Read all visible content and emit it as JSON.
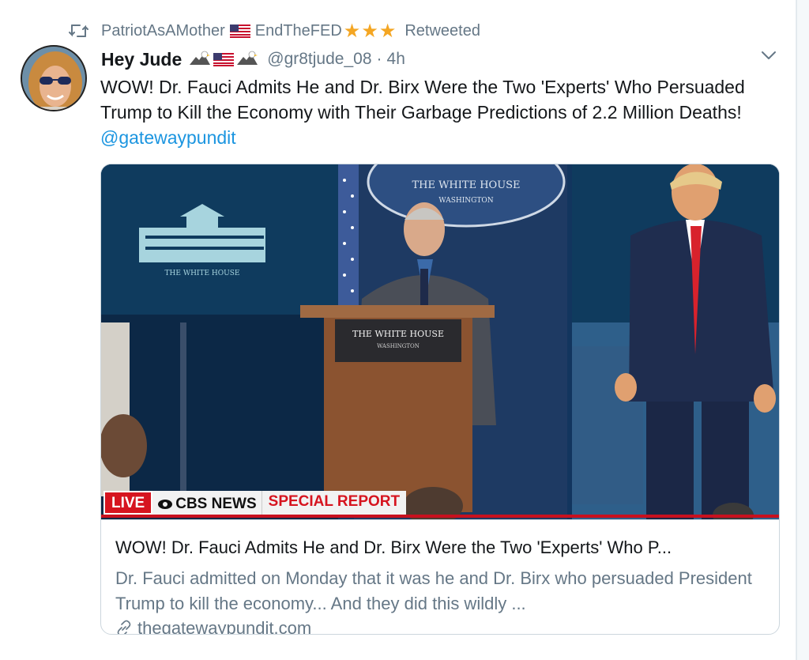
{
  "retweet": {
    "icon": "retweet-icon",
    "user1": "PatriotAsAMother",
    "user2": "EndTheFED",
    "stars": "★★★",
    "label": "Retweeted"
  },
  "tweet": {
    "display_name": "Hey Jude",
    "handle": "@gr8tjude_08",
    "dot": "·",
    "time": "4h",
    "text": "WOW! Dr. Fauci Admits He and Dr. Birx Were the Two 'Experts' Who Persuaded Trump to Kill the Economy with Their Garbage Predictions of 2.2 Million Deaths! ",
    "mention": "@gatewaypundit"
  },
  "card": {
    "title": "WOW! Dr. Fauci Admits He and Dr. Birx Were the Two 'Experts' Who P...",
    "description": "Dr. Fauci admitted on Monday that it was he and Dr. Birx who persuaded President Trump to kill the economy... And they did this wildly ...",
    "domain": "thegatewaypundit.com",
    "image": {
      "backdrop_text": "THE WHITE HOUSE",
      "seal_text": "THE WHITE HOUSE",
      "seal_sub": "WASHINGTON",
      "podium_text": "THE WHITE HOUSE",
      "podium_sub": "WASHINGTON",
      "live": "LIVE",
      "network": "CBS NEWS",
      "special": "SPECIAL REPORT"
    }
  },
  "colors": {
    "link": "#1b95e0",
    "secondary": "#657786",
    "live_red": "#d6141f",
    "star": "#f4a623"
  }
}
